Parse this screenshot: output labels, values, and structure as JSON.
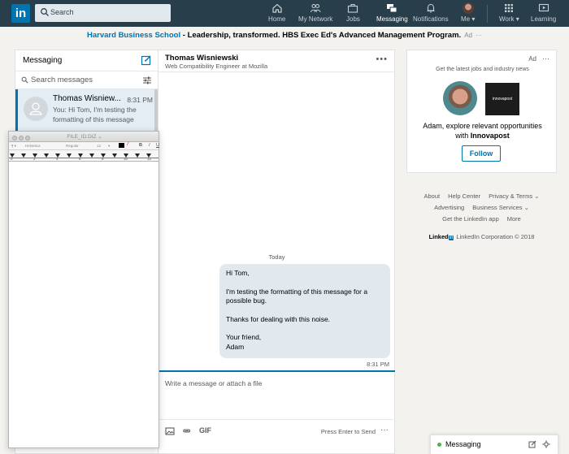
{
  "nav": {
    "logo": "in",
    "search_placeholder": "Search",
    "items": [
      {
        "label": "Home"
      },
      {
        "label": "My Network"
      },
      {
        "label": "Jobs"
      },
      {
        "label": "Messaging"
      },
      {
        "label": "Notifications"
      },
      {
        "label": "Me ▾"
      },
      {
        "label": "Work ▾"
      },
      {
        "label": "Learning"
      }
    ]
  },
  "ad_banner": {
    "company": "Harvard Business School",
    "text": " - Leadership, transformed. HBS Exec Ed's Advanced Management Program.",
    "ad_label": "Ad",
    "more": "···"
  },
  "messaging": {
    "title": "Messaging",
    "search_placeholder": "Search messages",
    "conversations": [
      {
        "name": "Thomas Wisniew...",
        "time": "8:31 PM",
        "snippet": "You: Hi Tom, I'm testing the formatting of this message"
      }
    ]
  },
  "conversation": {
    "name": "Thomas Wisniewski",
    "headline": "Web Compatibility Engineer at Mozilla",
    "more": "•••",
    "date_divider": "Today",
    "message": {
      "p1": "Hi Tom,",
      "p2": "I'm testing the formatting of this message for a possible bug.",
      "p3": "Thanks for dealing with this noise.",
      "p4a": "Your friend,",
      "p4b": "Adam",
      "time": "8:31 PM"
    },
    "composer": {
      "placeholder": "Write a message or attach a file",
      "gif": "GIF",
      "send_hint": "Press Enter to Send",
      "more": "···"
    }
  },
  "float_window": {
    "title": "FILE_ID.DIZ ⌄",
    "toolbar": [
      "¶ ▾",
      "Helvetica",
      "Regular",
      "12",
      "▾"
    ],
    "ruler_numbers": [
      "0",
      "2",
      "4",
      "6",
      "8",
      "10",
      "12"
    ]
  },
  "ad_card": {
    "ad_label": "Ad",
    "more": "···",
    "subtitle": "Get the latest jobs and industry news",
    "company_logo": "innovapost",
    "msg_line1": "Adam, explore relevant opportunities",
    "msg_line2_prefix": "with ",
    "msg_line2_company": "Innovapost",
    "follow": "Follow"
  },
  "footer": {
    "row1": [
      "About",
      "Help Center",
      "Privacy & Terms ⌄"
    ],
    "row2": [
      "Advertising",
      "Business Services ⌄"
    ],
    "row3": [
      "Get the LinkedIn app",
      "More"
    ],
    "brand_word": "Linked",
    "brand_in": "in",
    "copyright": "LinkedIn Corporation © 2018"
  },
  "bottom_bar": {
    "label": "Messaging"
  },
  "colors": {
    "nav_bg": "#283e4a",
    "brand_blue": "#0073b1",
    "bubble_bg": "#e1e9ee",
    "online_green": "#4fb04f"
  }
}
